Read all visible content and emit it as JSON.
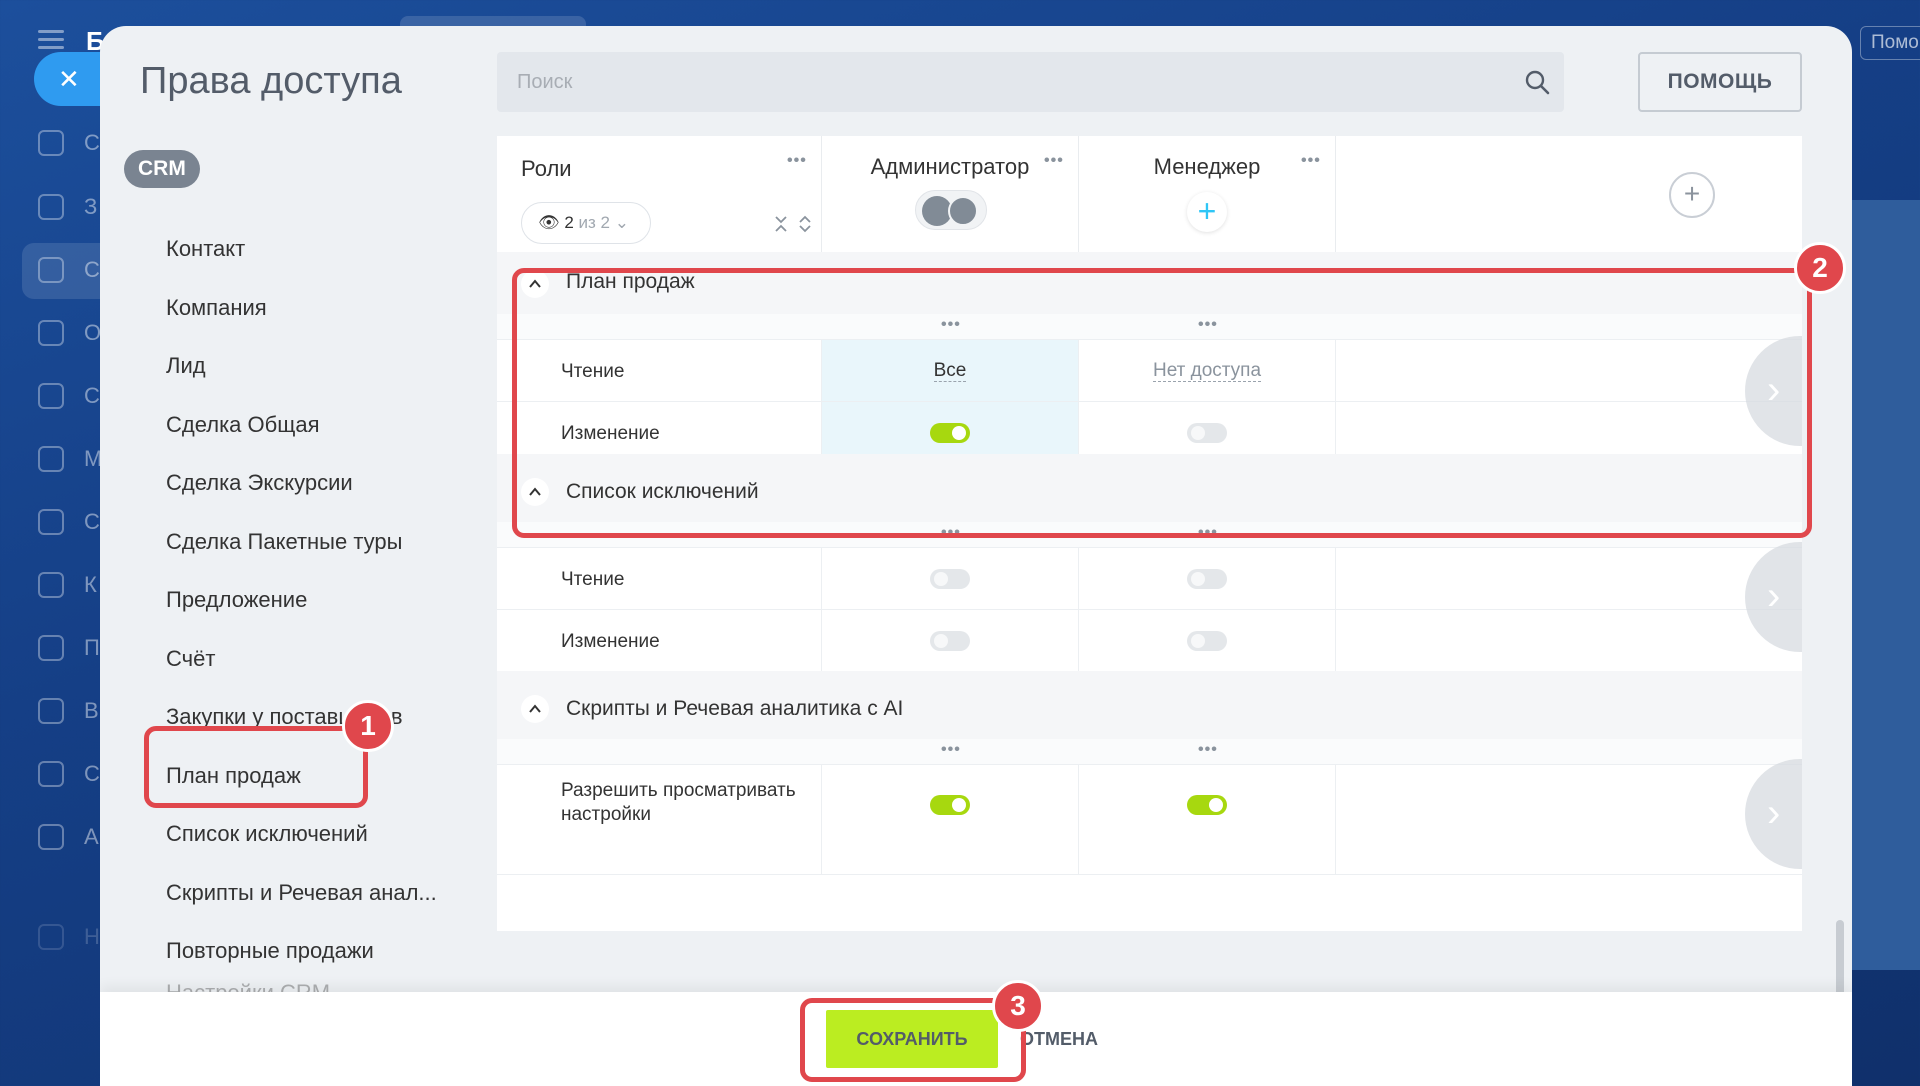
{
  "background": {
    "logo_letter": "Б",
    "nav_letters": [
      "С",
      "З",
      "С",
      "О",
      "С",
      "М",
      "С",
      "К",
      "П",
      "В",
      "С",
      "А",
      "Н"
    ],
    "help_button": "Помощь"
  },
  "panel": {
    "title": "Права доступа",
    "search": {
      "placeholder": "Поиск"
    },
    "help_button": "ПОМОЩЬ"
  },
  "sidebar": {
    "badge": "CRM",
    "items": [
      {
        "label": "Контакт"
      },
      {
        "label": "Компания"
      },
      {
        "label": "Лид"
      },
      {
        "label": "Сделка Общая"
      },
      {
        "label": "Сделка Экскурсии"
      },
      {
        "label": "Сделка Пакетные туры"
      },
      {
        "label": "Предложение"
      },
      {
        "label": "Счёт"
      },
      {
        "label": "Закупки у поставщиков"
      },
      {
        "label": "План продаж"
      },
      {
        "label": "Список исключений"
      },
      {
        "label": "Скрипты и Речевая анал..."
      },
      {
        "label": "Повторные продажи"
      },
      {
        "label": "Настройки CRM"
      }
    ]
  },
  "table": {
    "roles_label": "Роли",
    "filter": {
      "count": "2",
      "of_text": "из 2"
    },
    "roles": [
      {
        "name": "Администратор"
      },
      {
        "name": "Менеджер"
      }
    ],
    "sections": [
      {
        "title": "План продаж",
        "rows": [
          {
            "label": "Чтение",
            "admin": "Все",
            "manager": "Нет доступа"
          },
          {
            "label": "Изменение",
            "admin": "on",
            "manager": "off"
          }
        ]
      },
      {
        "title": "Список исключений",
        "rows": [
          {
            "label": "Чтение",
            "admin": "off",
            "manager": "off"
          },
          {
            "label": "Изменение",
            "admin": "off",
            "manager": "off"
          }
        ]
      },
      {
        "title": "Скрипты и Речевая аналитика с AI",
        "rows": [
          {
            "label": "Разрешить просматривать настройки",
            "admin": "on",
            "manager": "on"
          }
        ]
      }
    ]
  },
  "footer": {
    "save_label": "СОХРАНИТЬ",
    "cancel_label": "ОТМЕНА"
  },
  "annotations": [
    "1",
    "2",
    "3"
  ],
  "colors": {
    "accent_green": "#bbed21",
    "toggle_on": "#a7d80f",
    "callout_red": "#e0474c",
    "highlight_cell": "#e9f6fb"
  }
}
